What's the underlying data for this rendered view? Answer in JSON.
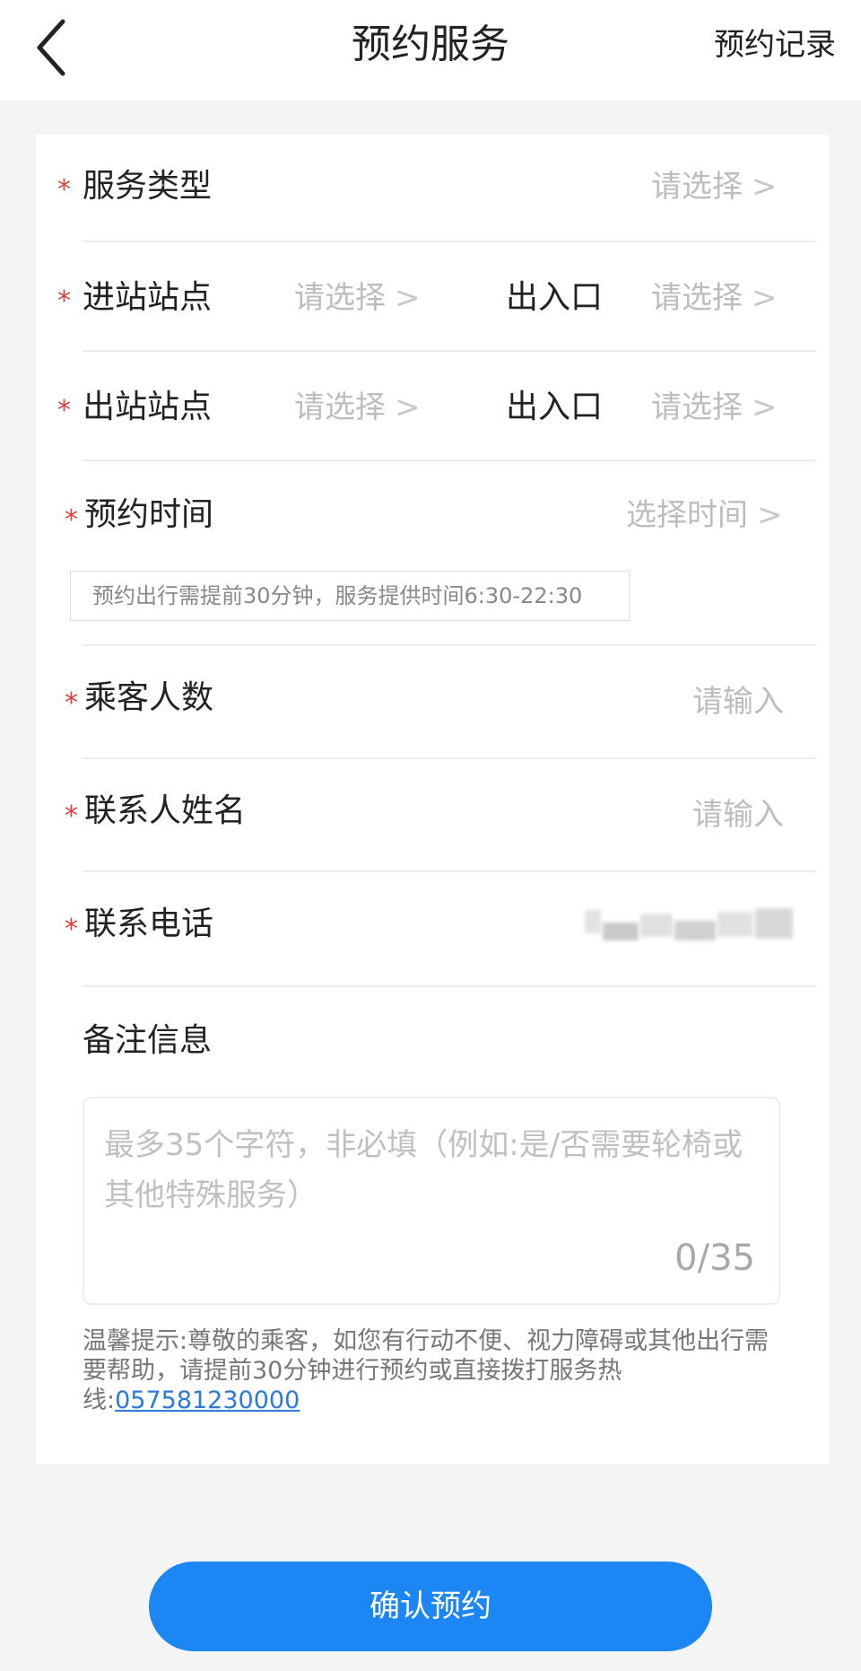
{
  "header": {
    "title": "预约服务",
    "records": "预约记录"
  },
  "form": {
    "required_mark": "*",
    "service_type": {
      "label": "服务类型",
      "placeholder": "请选择"
    },
    "entry_station": {
      "label": "进站站点",
      "placeholder": "请选择",
      "gate_label": "出入口",
      "gate_placeholder": "请选择"
    },
    "exit_station": {
      "label": "出站站点",
      "placeholder": "请选择",
      "gate_label": "出入口",
      "gate_placeholder": "请选择"
    },
    "booking_time": {
      "label": "预约时间",
      "placeholder": "选择时间",
      "hint": "预约出行需提前30分钟，服务提供时间6:30-22:30"
    },
    "passenger_count": {
      "label": "乘客人数",
      "placeholder": "请输入"
    },
    "contact_name": {
      "label": "联系人姓名",
      "placeholder": "请输入"
    },
    "contact_phone": {
      "label": "联系电话"
    },
    "remark": {
      "label": "备注信息",
      "placeholder": "最多35个字符，非必填（例如:是/否需要轮椅或其他特殊服务）",
      "counter": "0/35"
    }
  },
  "tip": {
    "text": "温馨提示:尊敬的乘客，如您有行动不便、视力障碍或其他出行需要帮助，请提前30分钟进行预约或直接拨打服务热线:",
    "hotline": "057581230000"
  },
  "confirm_button": "确认预约",
  "icons": {
    "back": "chevron-left-icon",
    "arrow": "chevron-right-icon"
  },
  "colors": {
    "primary": "#1d86f5",
    "required": "#d94141"
  }
}
